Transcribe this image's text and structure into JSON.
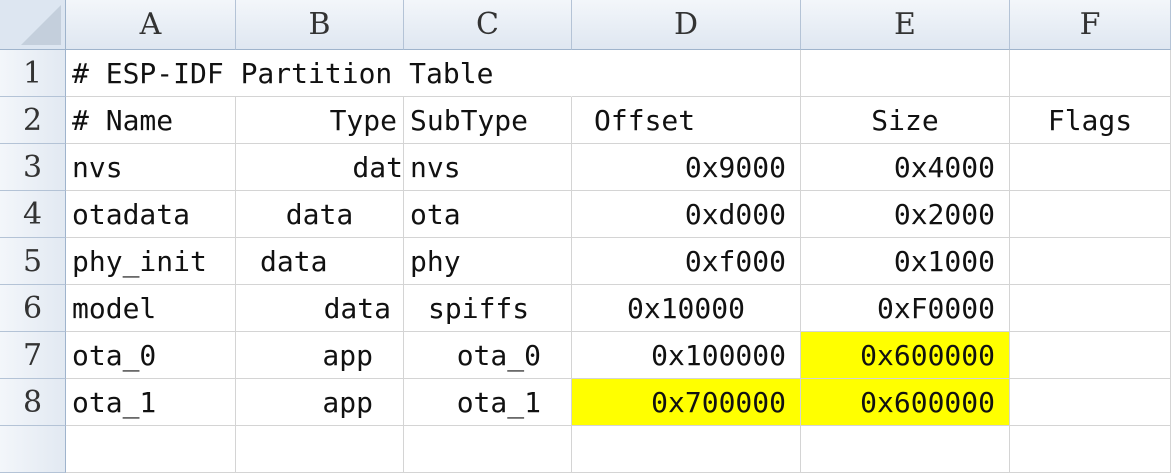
{
  "columns": [
    "A",
    "B",
    "C",
    "D",
    "E",
    "F"
  ],
  "rows": [
    "1",
    "2",
    "3",
    "4",
    "5",
    "6",
    "7",
    "8"
  ],
  "cells": {
    "r1": {
      "a": "# ESP-IDF Partition Table"
    },
    "r2": {
      "a": "# Name",
      "b": "Type",
      "c": "SubType",
      "d": "Offset",
      "e": "Size",
      "f": "Flags"
    },
    "r3": {
      "a": "nvs",
      "b": "dat",
      "c": "nvs",
      "d": "0x9000",
      "e": "0x4000"
    },
    "r4": {
      "a": "otadata",
      "b": "data",
      "c": "ota",
      "d": "0xd000",
      "e": "0x2000"
    },
    "r5": {
      "a": "phy_init",
      "b": "data",
      "c": "phy",
      "d": "0xf000",
      "e": "0x1000"
    },
    "r6": {
      "a": "model",
      "b": "data",
      "c": "spiffs",
      "d": "0x10000",
      "e": "0xF0000"
    },
    "r7": {
      "a": "ota_0",
      "b": "app",
      "c": "ota_0",
      "d": "0x100000",
      "e": "0x600000"
    },
    "r8": {
      "a": "ota_1",
      "b": "app",
      "c": "ota_1",
      "d": "0x700000",
      "e": "0x600000"
    }
  },
  "colors": {
    "highlight": "#ffff00",
    "header_bg": "#dfe7f1"
  }
}
